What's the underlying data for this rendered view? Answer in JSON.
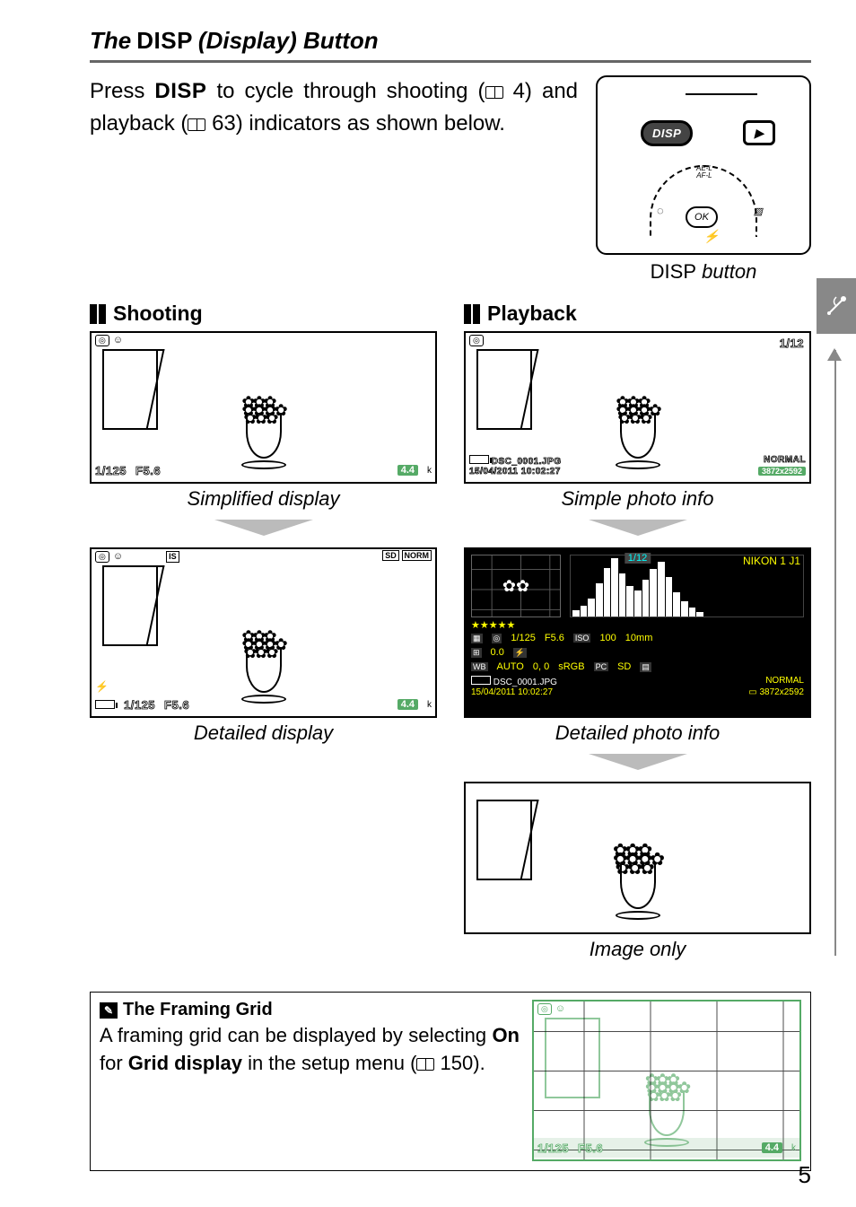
{
  "title": {
    "prefix": "The",
    "disp": "DISP",
    "suffix": "(Display) Button"
  },
  "intro": {
    "part1": "Press ",
    "disp": "DISP",
    "part2": " to cycle through shooting (",
    "ref1": "4",
    "part3": ") and playback (",
    "ref2": "63",
    "part4": ") indicators as shown below."
  },
  "camera_caption_prefix": "DISP",
  "camera_caption_suffix": " button",
  "camera": {
    "disp": "DISP",
    "play": "▶",
    "ok": "OK",
    "aeaf": "AE-L\nAF-L"
  },
  "shooting": {
    "heading": "Shooting",
    "simplified": {
      "caption": "Simplified display",
      "shutter": "1/125",
      "aperture": "F5.6",
      "shots": "4.4",
      "k": "k"
    },
    "detailed": {
      "caption": "Detailed display",
      "is_label": "IS",
      "sd_label": "SD",
      "norm_label": "NORM",
      "shutter": "1/125",
      "aperture": "F5.6",
      "shots": "4.4",
      "k": "k"
    }
  },
  "playback": {
    "heading": "Playback",
    "simple": {
      "caption": "Simple photo info",
      "frame": "1/12",
      "filename": "DSC_0001.JPG",
      "datetime": "15/04/2011 10:02:27",
      "quality": "NORMAL",
      "dims": "3872x2592"
    },
    "detailed": {
      "caption": "Detailed photo info",
      "frame": "1/12",
      "model": "NIKON 1 J1",
      "stars": "★★★★★",
      "shutter": "1/125",
      "aperture": "F5.6",
      "iso_label": "ISO",
      "iso": "100",
      "focal": "10mm",
      "ev": "0.0",
      "wb": "AUTO",
      "wb_fine": "0, 0",
      "colorspace": "sRGB",
      "pc": "SD",
      "filename": "DSC_0001.JPG",
      "datetime": "15/04/2011 10:02:27",
      "quality": "NORMAL",
      "dims": "3872x2592"
    },
    "image_only": {
      "caption": "Image only"
    }
  },
  "note": {
    "heading": "The Framing Grid",
    "part1": "A framing grid can be displayed by selecting ",
    "on": "On",
    "part2": " for ",
    "grid": "Grid display",
    "part3": " in the setup menu (",
    "ref": "150",
    "part4": ").",
    "fig": {
      "shutter": "1/125",
      "aperture": "F5.6",
      "shots": "4.4",
      "k": "k"
    }
  },
  "page_number": "5"
}
